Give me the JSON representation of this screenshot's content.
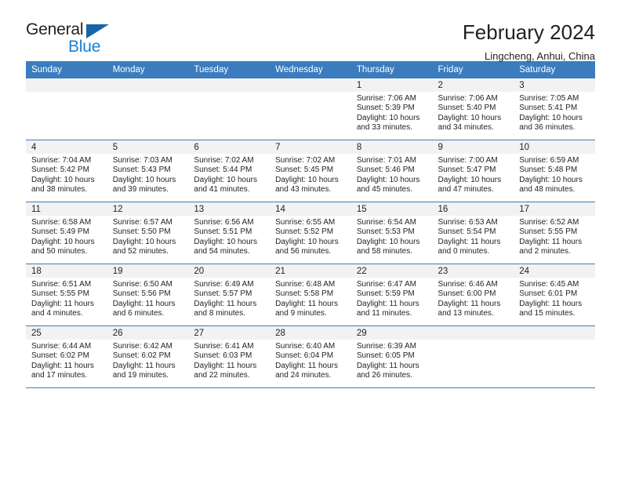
{
  "brand": {
    "name_part1": "General",
    "name_part2": "Blue",
    "triangle_color": "#1565a8",
    "blue_color": "#1b7fd4"
  },
  "header": {
    "title": "February 2024",
    "subtitle": "Lingcheng, Anhui, China"
  },
  "theme": {
    "header_blue": "#3a7cbe",
    "daynum_band": "#f2f2f2",
    "text": "#231f20"
  },
  "weekday_headers": [
    "Sunday",
    "Monday",
    "Tuesday",
    "Wednesday",
    "Thursday",
    "Friday",
    "Saturday"
  ],
  "weeks": [
    [
      {
        "day": "",
        "sunrise": "",
        "sunset": "",
        "daylight_line1": "",
        "daylight_line2": ""
      },
      {
        "day": "",
        "sunrise": "",
        "sunset": "",
        "daylight_line1": "",
        "daylight_line2": ""
      },
      {
        "day": "",
        "sunrise": "",
        "sunset": "",
        "daylight_line1": "",
        "daylight_line2": ""
      },
      {
        "day": "",
        "sunrise": "",
        "sunset": "",
        "daylight_line1": "",
        "daylight_line2": ""
      },
      {
        "day": "1",
        "sunrise": "Sunrise: 7:06 AM",
        "sunset": "Sunset: 5:39 PM",
        "daylight_line1": "Daylight: 10 hours",
        "daylight_line2": "and 33 minutes."
      },
      {
        "day": "2",
        "sunrise": "Sunrise: 7:06 AM",
        "sunset": "Sunset: 5:40 PM",
        "daylight_line1": "Daylight: 10 hours",
        "daylight_line2": "and 34 minutes."
      },
      {
        "day": "3",
        "sunrise": "Sunrise: 7:05 AM",
        "sunset": "Sunset: 5:41 PM",
        "daylight_line1": "Daylight: 10 hours",
        "daylight_line2": "and 36 minutes."
      }
    ],
    [
      {
        "day": "4",
        "sunrise": "Sunrise: 7:04 AM",
        "sunset": "Sunset: 5:42 PM",
        "daylight_line1": "Daylight: 10 hours",
        "daylight_line2": "and 38 minutes."
      },
      {
        "day": "5",
        "sunrise": "Sunrise: 7:03 AM",
        "sunset": "Sunset: 5:43 PM",
        "daylight_line1": "Daylight: 10 hours",
        "daylight_line2": "and 39 minutes."
      },
      {
        "day": "6",
        "sunrise": "Sunrise: 7:02 AM",
        "sunset": "Sunset: 5:44 PM",
        "daylight_line1": "Daylight: 10 hours",
        "daylight_line2": "and 41 minutes."
      },
      {
        "day": "7",
        "sunrise": "Sunrise: 7:02 AM",
        "sunset": "Sunset: 5:45 PM",
        "daylight_line1": "Daylight: 10 hours",
        "daylight_line2": "and 43 minutes."
      },
      {
        "day": "8",
        "sunrise": "Sunrise: 7:01 AM",
        "sunset": "Sunset: 5:46 PM",
        "daylight_line1": "Daylight: 10 hours",
        "daylight_line2": "and 45 minutes."
      },
      {
        "day": "9",
        "sunrise": "Sunrise: 7:00 AM",
        "sunset": "Sunset: 5:47 PM",
        "daylight_line1": "Daylight: 10 hours",
        "daylight_line2": "and 47 minutes."
      },
      {
        "day": "10",
        "sunrise": "Sunrise: 6:59 AM",
        "sunset": "Sunset: 5:48 PM",
        "daylight_line1": "Daylight: 10 hours",
        "daylight_line2": "and 48 minutes."
      }
    ],
    [
      {
        "day": "11",
        "sunrise": "Sunrise: 6:58 AM",
        "sunset": "Sunset: 5:49 PM",
        "daylight_line1": "Daylight: 10 hours",
        "daylight_line2": "and 50 minutes."
      },
      {
        "day": "12",
        "sunrise": "Sunrise: 6:57 AM",
        "sunset": "Sunset: 5:50 PM",
        "daylight_line1": "Daylight: 10 hours",
        "daylight_line2": "and 52 minutes."
      },
      {
        "day": "13",
        "sunrise": "Sunrise: 6:56 AM",
        "sunset": "Sunset: 5:51 PM",
        "daylight_line1": "Daylight: 10 hours",
        "daylight_line2": "and 54 minutes."
      },
      {
        "day": "14",
        "sunrise": "Sunrise: 6:55 AM",
        "sunset": "Sunset: 5:52 PM",
        "daylight_line1": "Daylight: 10 hours",
        "daylight_line2": "and 56 minutes."
      },
      {
        "day": "15",
        "sunrise": "Sunrise: 6:54 AM",
        "sunset": "Sunset: 5:53 PM",
        "daylight_line1": "Daylight: 10 hours",
        "daylight_line2": "and 58 minutes."
      },
      {
        "day": "16",
        "sunrise": "Sunrise: 6:53 AM",
        "sunset": "Sunset: 5:54 PM",
        "daylight_line1": "Daylight: 11 hours",
        "daylight_line2": "and 0 minutes."
      },
      {
        "day": "17",
        "sunrise": "Sunrise: 6:52 AM",
        "sunset": "Sunset: 5:55 PM",
        "daylight_line1": "Daylight: 11 hours",
        "daylight_line2": "and 2 minutes."
      }
    ],
    [
      {
        "day": "18",
        "sunrise": "Sunrise: 6:51 AM",
        "sunset": "Sunset: 5:55 PM",
        "daylight_line1": "Daylight: 11 hours",
        "daylight_line2": "and 4 minutes."
      },
      {
        "day": "19",
        "sunrise": "Sunrise: 6:50 AM",
        "sunset": "Sunset: 5:56 PM",
        "daylight_line1": "Daylight: 11 hours",
        "daylight_line2": "and 6 minutes."
      },
      {
        "day": "20",
        "sunrise": "Sunrise: 6:49 AM",
        "sunset": "Sunset: 5:57 PM",
        "daylight_line1": "Daylight: 11 hours",
        "daylight_line2": "and 8 minutes."
      },
      {
        "day": "21",
        "sunrise": "Sunrise: 6:48 AM",
        "sunset": "Sunset: 5:58 PM",
        "daylight_line1": "Daylight: 11 hours",
        "daylight_line2": "and 9 minutes."
      },
      {
        "day": "22",
        "sunrise": "Sunrise: 6:47 AM",
        "sunset": "Sunset: 5:59 PM",
        "daylight_line1": "Daylight: 11 hours",
        "daylight_line2": "and 11 minutes."
      },
      {
        "day": "23",
        "sunrise": "Sunrise: 6:46 AM",
        "sunset": "Sunset: 6:00 PM",
        "daylight_line1": "Daylight: 11 hours",
        "daylight_line2": "and 13 minutes."
      },
      {
        "day": "24",
        "sunrise": "Sunrise: 6:45 AM",
        "sunset": "Sunset: 6:01 PM",
        "daylight_line1": "Daylight: 11 hours",
        "daylight_line2": "and 15 minutes."
      }
    ],
    [
      {
        "day": "25",
        "sunrise": "Sunrise: 6:44 AM",
        "sunset": "Sunset: 6:02 PM",
        "daylight_line1": "Daylight: 11 hours",
        "daylight_line2": "and 17 minutes."
      },
      {
        "day": "26",
        "sunrise": "Sunrise: 6:42 AM",
        "sunset": "Sunset: 6:02 PM",
        "daylight_line1": "Daylight: 11 hours",
        "daylight_line2": "and 19 minutes."
      },
      {
        "day": "27",
        "sunrise": "Sunrise: 6:41 AM",
        "sunset": "Sunset: 6:03 PM",
        "daylight_line1": "Daylight: 11 hours",
        "daylight_line2": "and 22 minutes."
      },
      {
        "day": "28",
        "sunrise": "Sunrise: 6:40 AM",
        "sunset": "Sunset: 6:04 PM",
        "daylight_line1": "Daylight: 11 hours",
        "daylight_line2": "and 24 minutes."
      },
      {
        "day": "29",
        "sunrise": "Sunrise: 6:39 AM",
        "sunset": "Sunset: 6:05 PM",
        "daylight_line1": "Daylight: 11 hours",
        "daylight_line2": "and 26 minutes."
      },
      {
        "day": "",
        "sunrise": "",
        "sunset": "",
        "daylight_line1": "",
        "daylight_line2": ""
      },
      {
        "day": "",
        "sunrise": "",
        "sunset": "",
        "daylight_line1": "",
        "daylight_line2": ""
      }
    ]
  ]
}
